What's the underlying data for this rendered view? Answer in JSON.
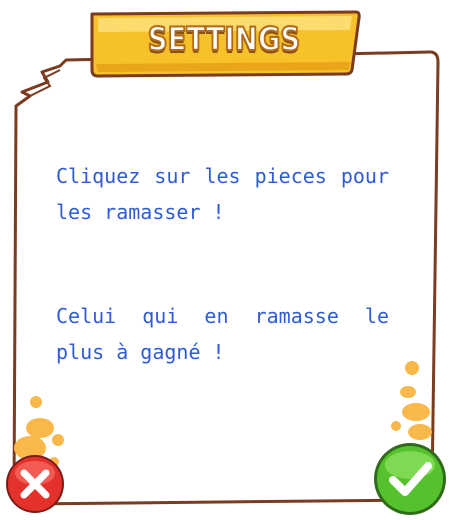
{
  "dialog": {
    "title": "SETTINGS",
    "paragraphs": [
      "Cliquez sur les pieces pour les ramasser !",
      "Celui qui en ramasse le plus à gagné !"
    ]
  },
  "buttons": {
    "cancel_icon": "close-icon",
    "confirm_icon": "checkmark-icon"
  },
  "colors": {
    "text": "#2f5bd8",
    "banner": "#f7c12a",
    "banner_border": "#7a3b1e",
    "panel_border": "#7a3b1e",
    "cancel": "#e4312b",
    "confirm": "#55c22d",
    "splash": "#f9b84a"
  }
}
